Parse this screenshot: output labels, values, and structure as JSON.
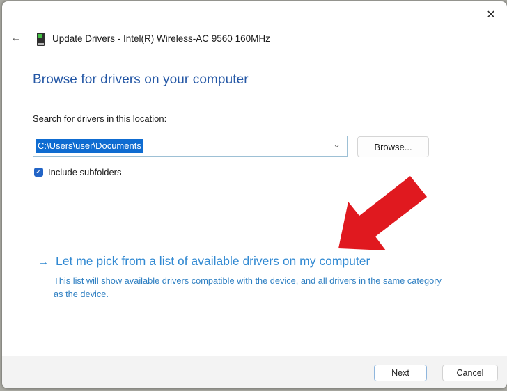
{
  "window": {
    "back_icon": "←",
    "close_icon": "✕",
    "title": "Update Drivers - Intel(R) Wireless-AC 9560 160MHz"
  },
  "main": {
    "heading": "Browse for drivers on your computer",
    "location_label": "Search for drivers in this location:",
    "location_value": "C:\\Users\\user\\Documents",
    "combo_chevron_icon": "⌄",
    "browse_label": "Browse...",
    "subfolders": {
      "checked": true,
      "check_icon": "✓",
      "label": "Include subfolders"
    },
    "pick_option": {
      "arrow_icon": "→",
      "label": "Let me pick from a list of available drivers on my computer",
      "description": "This list will show available drivers compatible with the device, and all drivers in the same category as the device."
    }
  },
  "footer": {
    "next_label": "Next",
    "cancel_label": "Cancel"
  },
  "colors": {
    "heading_blue": "#2457a5",
    "link_blue": "#3189d2",
    "selection_blue": "#0f6cd1",
    "checkbox_blue": "#2264c6",
    "annotation_red": "#e0191f",
    "footer_gray": "#f3f3f3"
  }
}
